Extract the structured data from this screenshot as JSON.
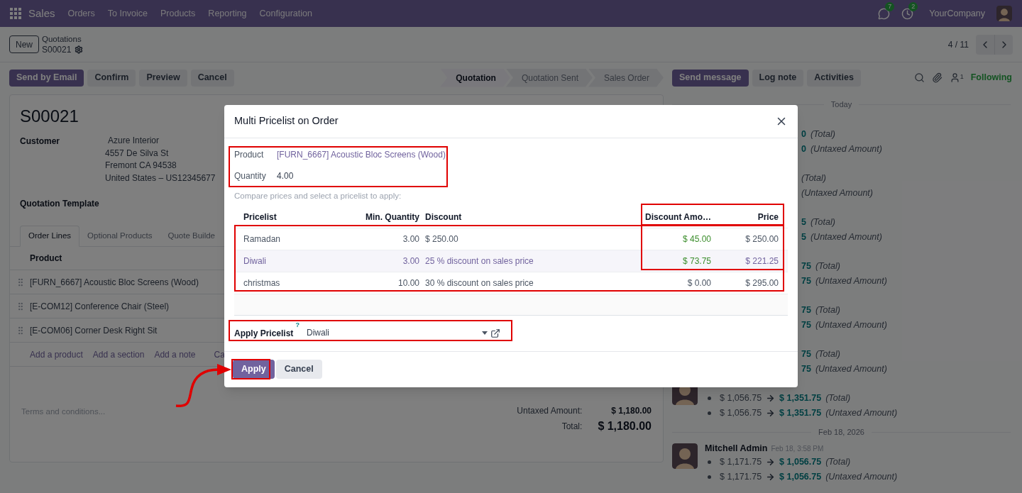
{
  "navbar": {
    "app": "Sales",
    "menu": [
      "Orders",
      "To Invoice",
      "Products",
      "Reporting",
      "Configuration"
    ],
    "messages_badge": "7",
    "activities_badge": "2",
    "company": "YourCompany"
  },
  "breadcrumb": {
    "new_button": "New",
    "parent": "Quotations",
    "current": "S00021",
    "pager": "4 / 11"
  },
  "actions": [
    {
      "label": "Send by Email",
      "primary": true
    },
    {
      "label": "Confirm",
      "primary": false
    },
    {
      "label": "Preview",
      "primary": false
    },
    {
      "label": "Cancel",
      "primary": false
    }
  ],
  "statusbar": [
    {
      "label": "Quotation",
      "selected": true
    },
    {
      "label": "Quotation Sent",
      "selected": false
    },
    {
      "label": "Sales Order",
      "selected": false
    }
  ],
  "chatter_buttons": [
    {
      "label": "Send message",
      "primary": true
    },
    {
      "label": "Log note",
      "primary": false
    },
    {
      "label": "Activities",
      "primary": false
    }
  ],
  "followers": "1",
  "follow_label": "Following",
  "form": {
    "title": "S00021",
    "customer_label": "Customer",
    "customer": [
      "Azure Interior",
      "4557 De Silva St",
      "Fremont CA 94538",
      "United States – US12345677"
    ],
    "template_label": "Quotation Template",
    "tabs": [
      {
        "label": "Order Lines",
        "selected": true
      },
      {
        "label": "Optional Products",
        "selected": false
      },
      {
        "label": "Quote Builde",
        "selected": false
      }
    ],
    "product_header": "Product",
    "lines": [
      "[FURN_6667] Acoustic Bloc Screens (Wood)",
      "[E-COM12] Conference Chair (Steel)",
      "[E-COM06] Corner Desk Right Sit"
    ],
    "add_links": [
      "Add a product",
      "Add a section",
      "Add a note",
      "Ca"
    ],
    "terms_placeholder": "Terms and conditions...",
    "totals": [
      {
        "label": "Untaxed Amount:",
        "value": "$ 1,180.00",
        "kind": "subtotal"
      },
      {
        "label": "Total:",
        "value": "$ 1,180.00",
        "kind": "total"
      }
    ]
  },
  "chatter": {
    "groups": [
      {
        "date": "Today",
        "messages": [
          {
            "changes": [
              {
                "new": "0",
                "field": "(Total)"
              },
              {
                "new": "0",
                "field": "(Untaxed Amount)"
              }
            ]
          },
          {
            "changes": [
              {
                "field": "(Total)"
              },
              {
                "field": "(Untaxed Amount)"
              }
            ]
          },
          {
            "changes": [
              {
                "new": "5",
                "field": "(Total)"
              },
              {
                "new": "5",
                "field": "(Untaxed Amount)"
              }
            ]
          },
          {
            "changes": [
              {
                "new": "75",
                "field": "(Total)"
              },
              {
                "new": "75",
                "field": "(Untaxed Amount)"
              }
            ]
          },
          {
            "changes": [
              {
                "new": "75",
                "field": "(Total)"
              },
              {
                "new": "75",
                "field": "(Untaxed Amount)"
              }
            ]
          },
          {
            "changes": [
              {
                "new": "75",
                "field": "(Total)"
              },
              {
                "new": "75",
                "field": "(Untaxed Amount)"
              }
            ]
          },
          {
            "avatar": true,
            "changes": [
              {
                "old": "$ 1,056.75",
                "new": "$ 1,351.75",
                "field": "(Total)"
              },
              {
                "old": "$ 1,056.75",
                "new": "$ 1,351.75",
                "field": "(Untaxed Amount)"
              }
            ]
          }
        ]
      },
      {
        "date": "Feb 18, 2026",
        "messages": [
          {
            "avatar": true,
            "author": "Mitchell Admin",
            "time": "Feb 18, 3:58 PM",
            "changes": [
              {
                "old": "$ 1,171.75",
                "new": "$ 1,056.75",
                "field": "(Total)"
              },
              {
                "old": "$ 1,171.75",
                "new": "$ 1,056.75",
                "field": "(Untaxed Amount)"
              }
            ]
          }
        ]
      }
    ]
  },
  "dialog": {
    "title": "Multi Pricelist on Order",
    "product_label": "Product",
    "product": "[FURN_6667] Acoustic Bloc Screens (Wood)",
    "quantity_label": "Quantity",
    "quantity": "4.00",
    "hint": "Compare prices and select a pricelist to apply:",
    "columns": [
      "Pricelist",
      "Min. Quantity",
      "Discount",
      "Discount Amo…",
      "Price"
    ],
    "rows": [
      {
        "pricelist": "Ramadan",
        "min_quantity": "3.00",
        "discount": "$ 250.00",
        "discount_amount": "$ 45.00",
        "color": "#3c8e2d",
        "price": "$ 250.00",
        "selected": false
      },
      {
        "pricelist": "Diwali",
        "min_quantity": "3.00",
        "discount": "25 % discount on sales price",
        "discount_amount": "$ 73.75",
        "color": "#3c8e2d",
        "price": "$ 221.25",
        "selected": true
      },
      {
        "pricelist": "christmas",
        "min_quantity": "10.00",
        "discount": "30 % discount on sales price",
        "discount_amount": "$ 0.00",
        "color": "#4b5563",
        "price": "$ 295.00",
        "selected": false
      }
    ],
    "apply_label": "Apply Pricelist",
    "help_mark": "?",
    "apply_value": "Diwali",
    "buttons": [
      {
        "label": "Apply",
        "primary": true
      },
      {
        "label": "Cancel",
        "primary": false
      }
    ]
  }
}
